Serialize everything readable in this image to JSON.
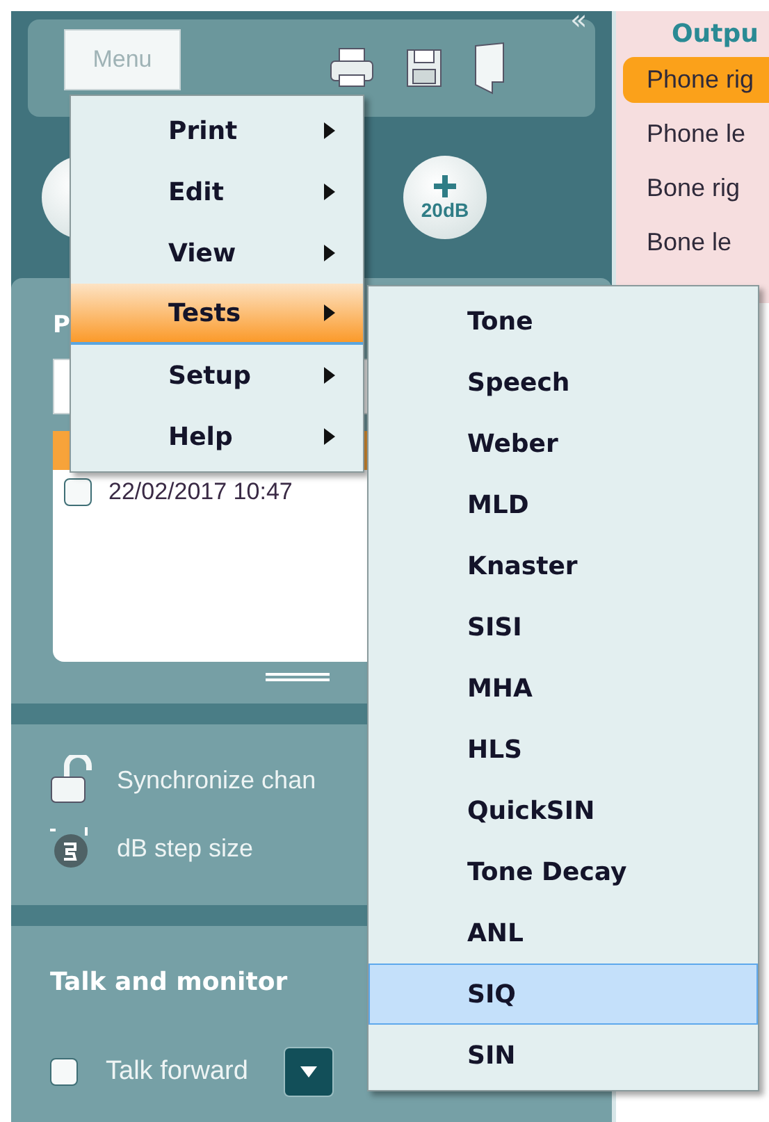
{
  "toolbar": {
    "menu_button": "Menu",
    "collapse": "«"
  },
  "level_button": {
    "label": "20dB"
  },
  "sessions_panel": {
    "title": "P",
    "current_session": {
      "selected": true
    },
    "sessions": [
      {
        "label": "22/02/2017 10:47",
        "checked": false,
        "selected": false
      }
    ]
  },
  "settings": [
    {
      "kind": "lock",
      "label": "Synchronize chan"
    },
    {
      "kind": "step",
      "label": "dB step size"
    }
  ],
  "talk_monitor": {
    "title": "Talk and monitor",
    "talk_forward": {
      "label": "Talk forward",
      "checked": false
    }
  },
  "output": {
    "title": "Outpu",
    "items": [
      {
        "label": "Phone rig",
        "selected": true
      },
      {
        "label": "Phone le",
        "selected": false
      },
      {
        "label": "Bone rig",
        "selected": false
      },
      {
        "label": "Bone le",
        "selected": false
      }
    ]
  },
  "menu": {
    "items": [
      {
        "label": "Print",
        "selected": false
      },
      {
        "label": "Edit",
        "selected": false
      },
      {
        "label": "View",
        "selected": false
      },
      {
        "label": "Tests",
        "selected": true
      },
      {
        "label": "Setup",
        "selected": false
      },
      {
        "label": "Help",
        "selected": false
      }
    ]
  },
  "submenu": {
    "items": [
      {
        "label": "Tone",
        "selected": false
      },
      {
        "label": "Speech",
        "selected": false
      },
      {
        "label": "Weber",
        "selected": false
      },
      {
        "label": "MLD",
        "selected": false
      },
      {
        "label": "Knaster",
        "selected": false
      },
      {
        "label": "SISI",
        "selected": false
      },
      {
        "label": "MHA",
        "selected": false
      },
      {
        "label": "HLS",
        "selected": false
      },
      {
        "label": "QuickSIN",
        "selected": false
      },
      {
        "label": "Tone Decay",
        "selected": false
      },
      {
        "label": "ANL",
        "selected": false
      },
      {
        "label": "SIQ",
        "selected": true
      },
      {
        "label": "SIN",
        "selected": false
      }
    ]
  }
}
